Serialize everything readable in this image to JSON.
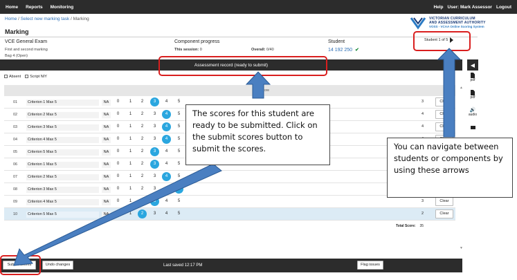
{
  "topnav": {
    "home": "Home",
    "reports": "Reports",
    "monitoring": "Monitoring",
    "help": "Help",
    "user": "User: Mark Assessor",
    "logout": "Logout"
  },
  "breadcrumb": {
    "home": "Home",
    "sep1": " / ",
    "task": "Select new marking task",
    "sep2": " / ",
    "current": "Marking"
  },
  "logo": {
    "line1": "VICTORIAN CURRICULUM",
    "line2": "AND ASSESSMENT AUTHORITY",
    "sub": "VOSS - VCAA Online Scoring System"
  },
  "page_title": "Marking",
  "exam": {
    "name": "VCE General Exam",
    "marking": "First and second marking",
    "bag": "Bag 4   (Open)"
  },
  "progress": {
    "title": "Component progress",
    "session_label": "This session:",
    "session_value": "0",
    "overall_label": "Overall:",
    "overall_value": "0/40"
  },
  "student": {
    "label": "Student",
    "number": "14 192 250",
    "check": "✔",
    "nav": "Student 1 of 5"
  },
  "record_bar": "Assessment record (ready to submit)",
  "sidebar": {
    "collapse": "◀",
    "items": [
      {
        "label": "pdf",
        "icon": "document-icon"
      },
      {
        "label": "pdf",
        "icon": "document-icon"
      },
      {
        "label": "audio",
        "icon": "speaker-icon"
      },
      {
        "label": "",
        "icon": "video-icon"
      }
    ]
  },
  "checkboxes": {
    "absent": "Absent",
    "script": "Script NIY"
  },
  "table": {
    "header": "Score",
    "scores": [
      "0",
      "1",
      "2",
      "3",
      "4",
      "5"
    ],
    "clear": "Clear",
    "rows": [
      {
        "num": "01",
        "crit": "Criterion 1 Max 5",
        "na": "NA",
        "sel": 3,
        "val": "3"
      },
      {
        "num": "02",
        "crit": "Criterion 2 Max 5",
        "na": "NA",
        "sel": 4,
        "val": "4"
      },
      {
        "num": "03",
        "crit": "Criterion 3 Max 5",
        "na": "NA",
        "sel": 4,
        "val": "4"
      },
      {
        "num": "04",
        "crit": "Criterion 4 Max 5",
        "na": "NA",
        "sel": 4,
        "val": "4"
      },
      {
        "num": "05",
        "crit": "Criterion 5 Max 5",
        "na": "NA",
        "sel": 3,
        "val": "3"
      },
      {
        "num": "06",
        "crit": "Criterion 1 Max 5",
        "na": "NA",
        "sel": 3,
        "val": "3"
      },
      {
        "num": "07",
        "crit": "Criterion 2 Max 5",
        "na": "NA",
        "sel": 4,
        "val": "4"
      },
      {
        "num": "08",
        "crit": "Criterion 3 Max 5",
        "na": "NA",
        "sel": 5,
        "val": "5"
      },
      {
        "num": "09",
        "crit": "Criterion 4 Max 5",
        "na": "NA",
        "sel": 3,
        "val": "3"
      },
      {
        "num": "10",
        "crit": "Criterion 5 Max 5",
        "na": "NA",
        "sel": 2,
        "val": "2"
      }
    ],
    "total_label": "Total Score:",
    "total_value": "35"
  },
  "bottom": {
    "submit": "Submit scores",
    "undo": "Undo changes",
    "saved": "Last saved 12:17 PM",
    "flag": "Flag issues"
  },
  "callouts": {
    "submit_note": "The scores for this student are ready to be submitted. Click on the submit scores button to submit the scores.",
    "nav_note": "You can navigate between students or components by using these arrows"
  },
  "colors": {
    "dark_bar": "#2c2c2c",
    "score_highlight": "#2aa6df",
    "annotation_red": "#d91e1e",
    "arrow_blue": "#4a7fc1",
    "selected_row": "#dcebf5"
  }
}
